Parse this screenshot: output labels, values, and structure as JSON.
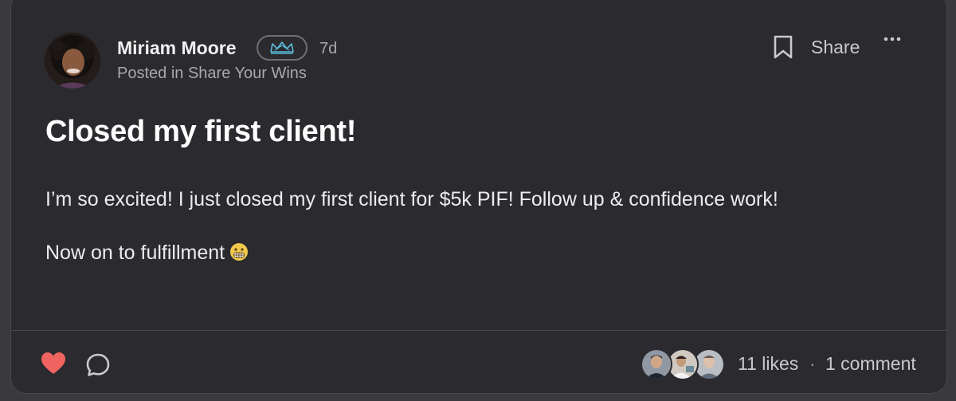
{
  "post": {
    "author_name": "Miriam Moore",
    "badge_icon": "crown-icon",
    "time_ago": "7d",
    "posted_in": "Posted in Share Your Wins",
    "title": "Closed my first client!",
    "body_paragraph_1": "I’m so excited! I just closed my first client for $5k PIF! Follow up & confidence work!",
    "body_paragraph_2": "Now on to fulfillment",
    "emoji": "grimacing-face"
  },
  "actions": {
    "share_label": "Share",
    "bookmark_icon": "bookmark-icon",
    "more_icon": "more-horizontal-icon",
    "like_icon": "heart-icon",
    "comment_icon": "speech-bubble-icon"
  },
  "stats": {
    "likes": "11 likes",
    "separator": "·",
    "comments": "1 comment"
  },
  "colors": {
    "card_bg": "#2b2b2f",
    "page_bg": "#3a3a3e",
    "like_red": "#ef6461",
    "badge_blue": "#5bb8d6",
    "text_primary": "#ffffff",
    "text_muted": "#a8a8ad"
  }
}
